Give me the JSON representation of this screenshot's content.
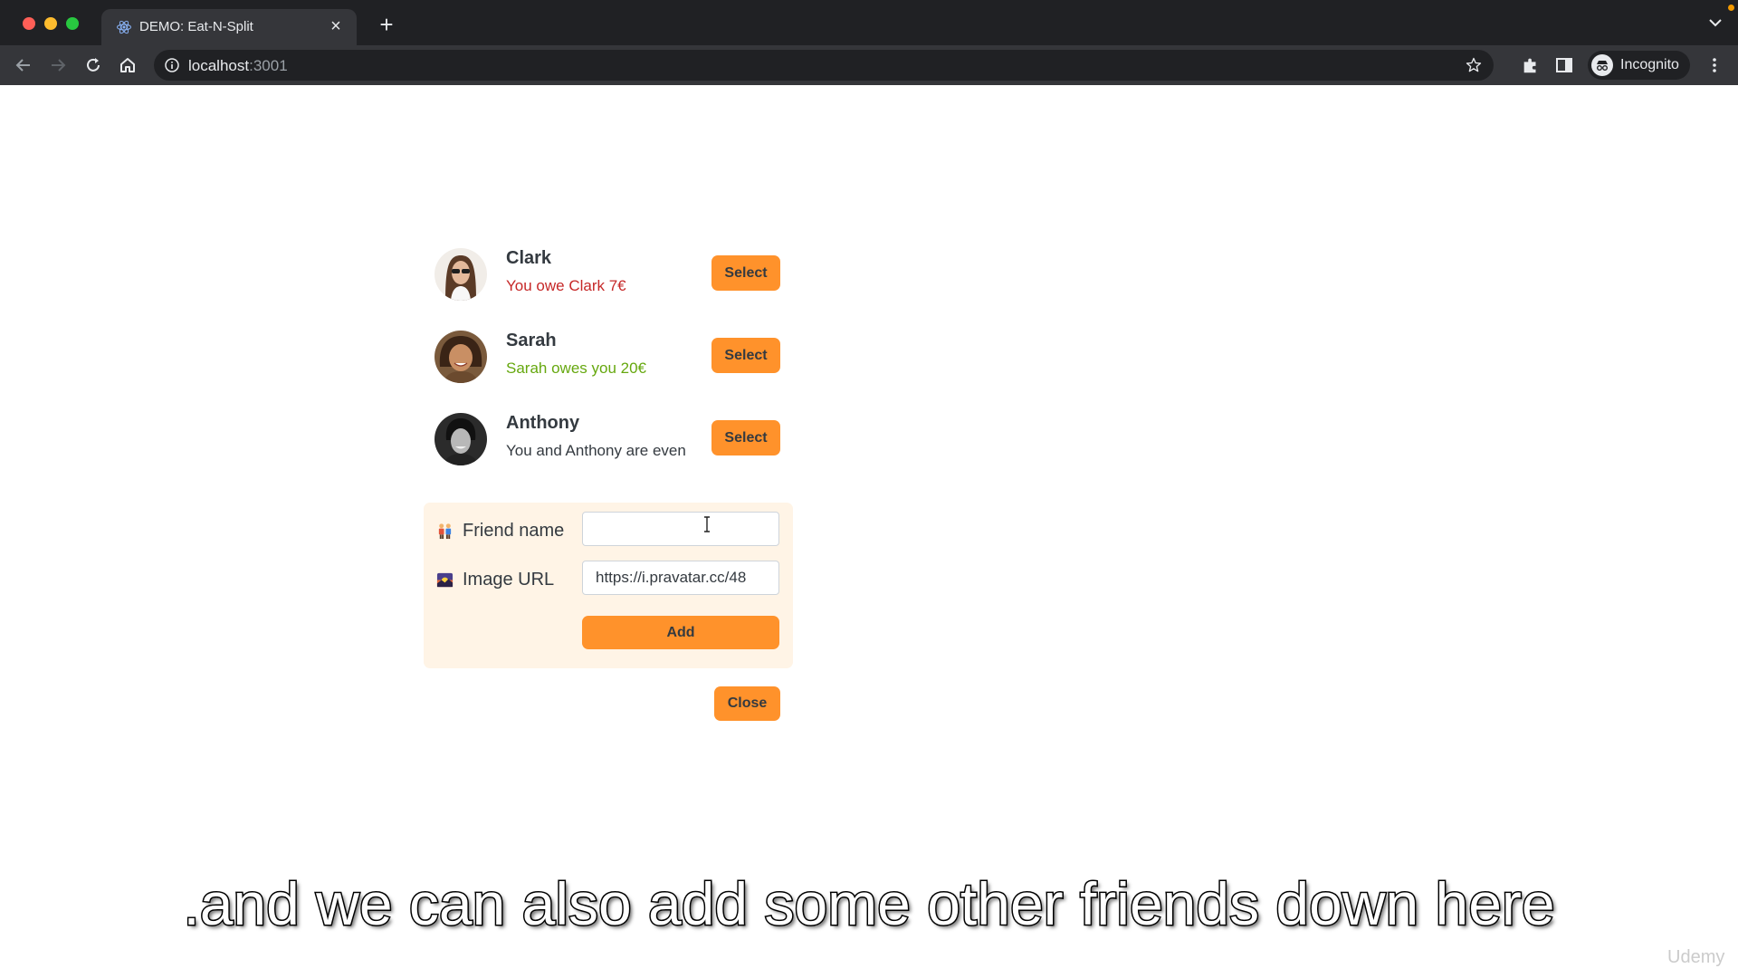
{
  "browser": {
    "tab_title": "DEMO: Eat-N-Split",
    "tab_close": "×",
    "new_tab": "+",
    "url_host": "localhost",
    "url_port": ":3001",
    "profile_label": "Incognito"
  },
  "friends": [
    {
      "name": "Clark",
      "status": "You owe Clark 7€",
      "balance": -7,
      "select_label": "Select"
    },
    {
      "name": "Sarah",
      "status": "Sarah owes you 20€",
      "balance": 20,
      "select_label": "Select"
    },
    {
      "name": "Anthony",
      "status": "You and Anthony are even",
      "balance": 0,
      "select_label": "Select"
    }
  ],
  "add_form": {
    "name_label": "Friend name",
    "name_value": "",
    "image_label": "Image URL",
    "image_value": "https://i.pravatar.cc/48",
    "add_label": "Add",
    "name_icon": "people-holding-hands-icon",
    "image_icon": "sunset-image-icon"
  },
  "close_label": "Close",
  "caption": ".and we can also add some other friends down here",
  "watermark": "Udemy",
  "colors": {
    "accent": "#ff922b",
    "form_bg": "#fff4e6",
    "owe": "#c62828",
    "owed": "#66a80f",
    "text": "#343a40"
  }
}
